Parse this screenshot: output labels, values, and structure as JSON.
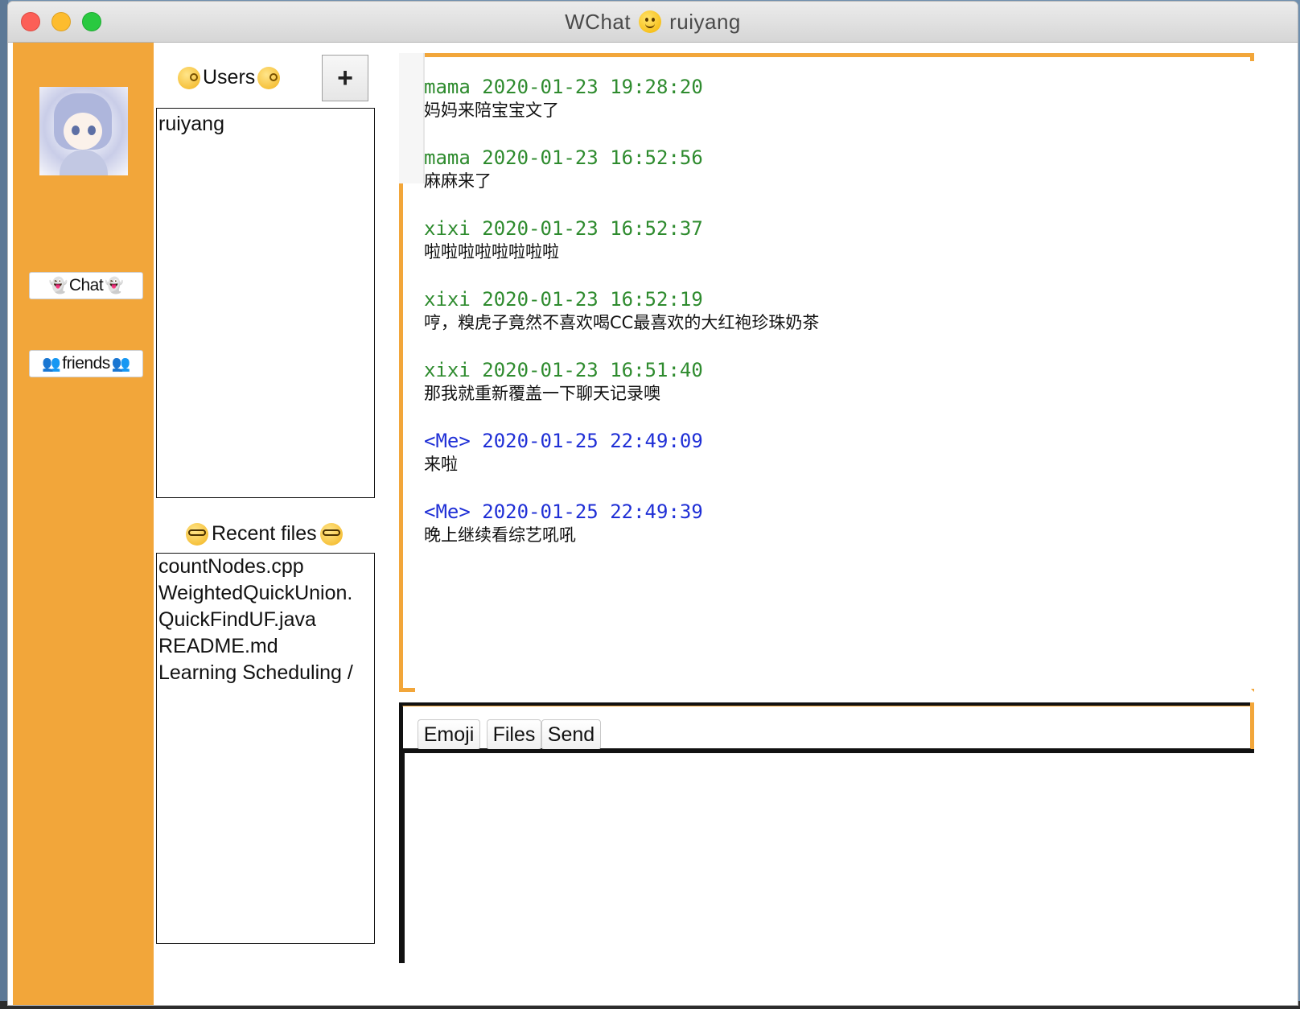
{
  "window": {
    "title_app": "WChat",
    "title_user": "ruiyang"
  },
  "sidebar": {
    "chat_label": "Chat",
    "friends_label": "friends",
    "accent_color": "#f2a63a"
  },
  "users": {
    "header": "Users",
    "add_label": "+",
    "items": [
      "ruiyang"
    ]
  },
  "files": {
    "header": "Recent files",
    "items": [
      "countNodes.cpp",
      "WeightedQuickUnion.",
      "QuickFindUF.java",
      "README.md",
      "Learning Scheduling /"
    ]
  },
  "messages": [
    {
      "sender": "mama",
      "time": "2020-01-23 19:28:20",
      "text": "妈妈来陪宝宝文了",
      "me": false
    },
    {
      "sender": "mama",
      "time": "2020-01-23 16:52:56",
      "text": "麻麻来了",
      "me": false
    },
    {
      "sender": "xixi",
      "time": "2020-01-23 16:52:37",
      "text": "啦啦啦啦啦啦啦啦",
      "me": false
    },
    {
      "sender": "xixi",
      "time": "2020-01-23 16:52:19",
      "text": "哼，糗虎子竟然不喜欢喝CC最喜欢的大红袍珍珠奶茶",
      "me": false
    },
    {
      "sender": "xixi",
      "time": "2020-01-23 16:51:40",
      "text": "那我就重新覆盖一下聊天记录噢",
      "me": false
    },
    {
      "sender": "<Me>",
      "time": "2020-01-25 22:49:09",
      "text": "来啦",
      "me": true
    },
    {
      "sender": "<Me>",
      "time": "2020-01-25 22:49:39",
      "text": "晚上继续看综艺吼吼",
      "me": true
    }
  ],
  "compose": {
    "emoji_label": "Emoji",
    "files_label": "Files",
    "send_label": "Send",
    "input_value": ""
  }
}
